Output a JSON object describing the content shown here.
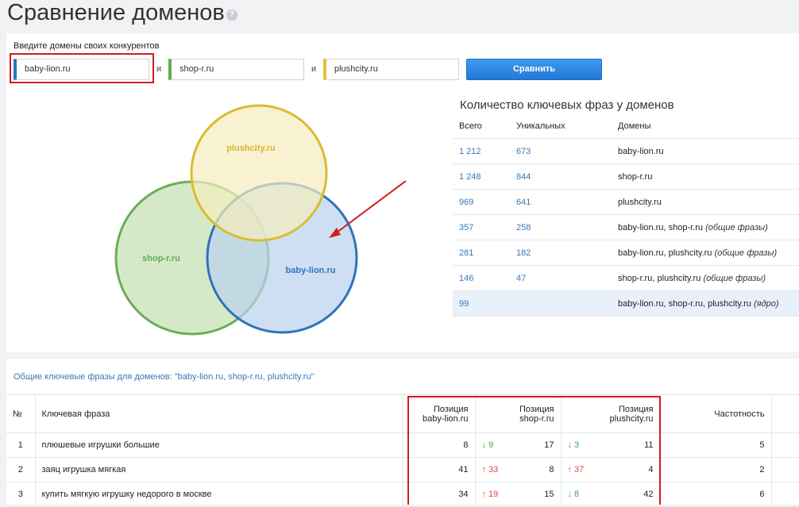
{
  "page": {
    "title": "Сравнение доменов",
    "help_icon": "?"
  },
  "form": {
    "caption": "Введите домены своих конкурентов",
    "domain1": "baby-lion.ru",
    "domain2": "shop-r.ru",
    "domain3": "plushcity.ru",
    "sep": "и",
    "compare_label": "Сравнить"
  },
  "colors": {
    "domain1": "#2f73b9",
    "domain2": "#5fae4f",
    "domain3": "#e0c23a",
    "accent": "#2278d6",
    "highlight": "#d21b22"
  },
  "venn": {
    "label1": "baby-lion.ru",
    "label2": "shop-r.ru",
    "label3": "plushcity.ru"
  },
  "stats": {
    "title": "Количество ключевых фраз у доменов",
    "headers": [
      "Всего",
      "Уникальных",
      "Домены"
    ],
    "rows": [
      {
        "total": "1 212",
        "unique": "673",
        "domains": "baby-lion.ru",
        "note": ""
      },
      {
        "total": "1 248",
        "unique": "844",
        "domains": "shop-r.ru",
        "note": ""
      },
      {
        "total": "969",
        "unique": "641",
        "domains": "plushcity.ru",
        "note": ""
      },
      {
        "total": "357",
        "unique": "258",
        "domains": "baby-lion.ru, shop-r.ru",
        "note": "(общие фразы)"
      },
      {
        "total": "281",
        "unique": "182",
        "domains": "baby-lion.ru, plushcity.ru",
        "note": "(общие фразы)"
      },
      {
        "total": "146",
        "unique": "47",
        "domains": "shop-r.ru, plushcity.ru",
        "note": "(общие фразы)"
      },
      {
        "total": "99",
        "unique": "",
        "domains": "baby-lion.ru, shop-r.ru, plushcity.ru",
        "note": "(ядро)"
      }
    ]
  },
  "common": {
    "caption": "Общие ключевые фразы для доменов: \"baby-lion.ru, shop-r.ru, plushcity.ru\"",
    "headers": {
      "num": "№",
      "phrase": "Ключевая фраза",
      "pos1_a": "Позиция",
      "pos1_b": "baby-lion.ru",
      "pos2_a": "Позиция",
      "pos2_b": "shop-r.ru",
      "pos3_a": "Позиция",
      "pos3_b": "plushcity.ru",
      "freq": "Частотность"
    },
    "rows": [
      {
        "n": "1",
        "phrase": "плюшевые игрушки большие",
        "p1": "8",
        "d2": "↓ 9",
        "d2dir": "down",
        "p2": "17",
        "d3": "↓ 3",
        "d3dir": "down",
        "p3": "11",
        "freq": "5"
      },
      {
        "n": "2",
        "phrase": "заяц игрушка мягкая",
        "p1": "41",
        "d2": "↑ 33",
        "d2dir": "up",
        "p2": "8",
        "d3": "↑ 37",
        "d3dir": "up",
        "p3": "4",
        "freq": "2"
      },
      {
        "n": "3",
        "phrase": "купить мягкую игрушку недорого в москве",
        "p1": "34",
        "d2": "↑ 19",
        "d2dir": "up",
        "p2": "15",
        "d3": "↓ 8",
        "d3dir": "down",
        "p3": "42",
        "freq": "6"
      }
    ]
  }
}
